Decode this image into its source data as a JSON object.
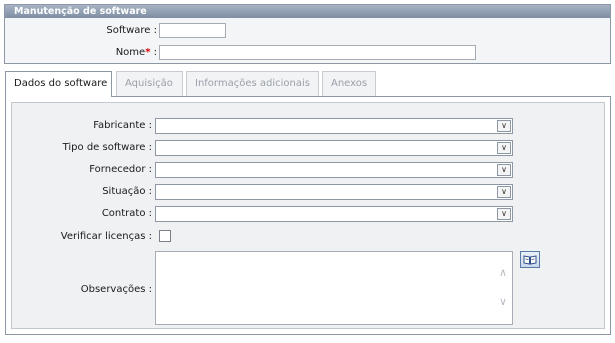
{
  "panel": {
    "title": "Manutenção de software",
    "software_label": "Software :",
    "nome_label": "Nome",
    "nome_required": "*",
    "nome_colon": " :",
    "software_value": "",
    "nome_value": ""
  },
  "tabs": [
    {
      "label": "Dados do software",
      "active": true
    },
    {
      "label": "Aquisição",
      "active": false
    },
    {
      "label": "Informações adicionais",
      "active": false
    },
    {
      "label": "Anexos",
      "active": false
    }
  ],
  "form": {
    "fabricante_label": "Fabricante :",
    "tipo_label": "Tipo de software :",
    "fornecedor_label": "Fornecedor :",
    "situacao_label": "Situação :",
    "contrato_label": "Contrato :",
    "verificar_label": "Verificar licenças :",
    "observacoes_label": "Observações :",
    "fabricante_value": "",
    "tipo_value": "",
    "fornecedor_value": "",
    "situacao_value": "",
    "contrato_value": "",
    "verificar_checked": false,
    "observacoes_value": ""
  },
  "icons": {
    "dropdown": "chevron-down-icon",
    "book": "book-icon"
  }
}
